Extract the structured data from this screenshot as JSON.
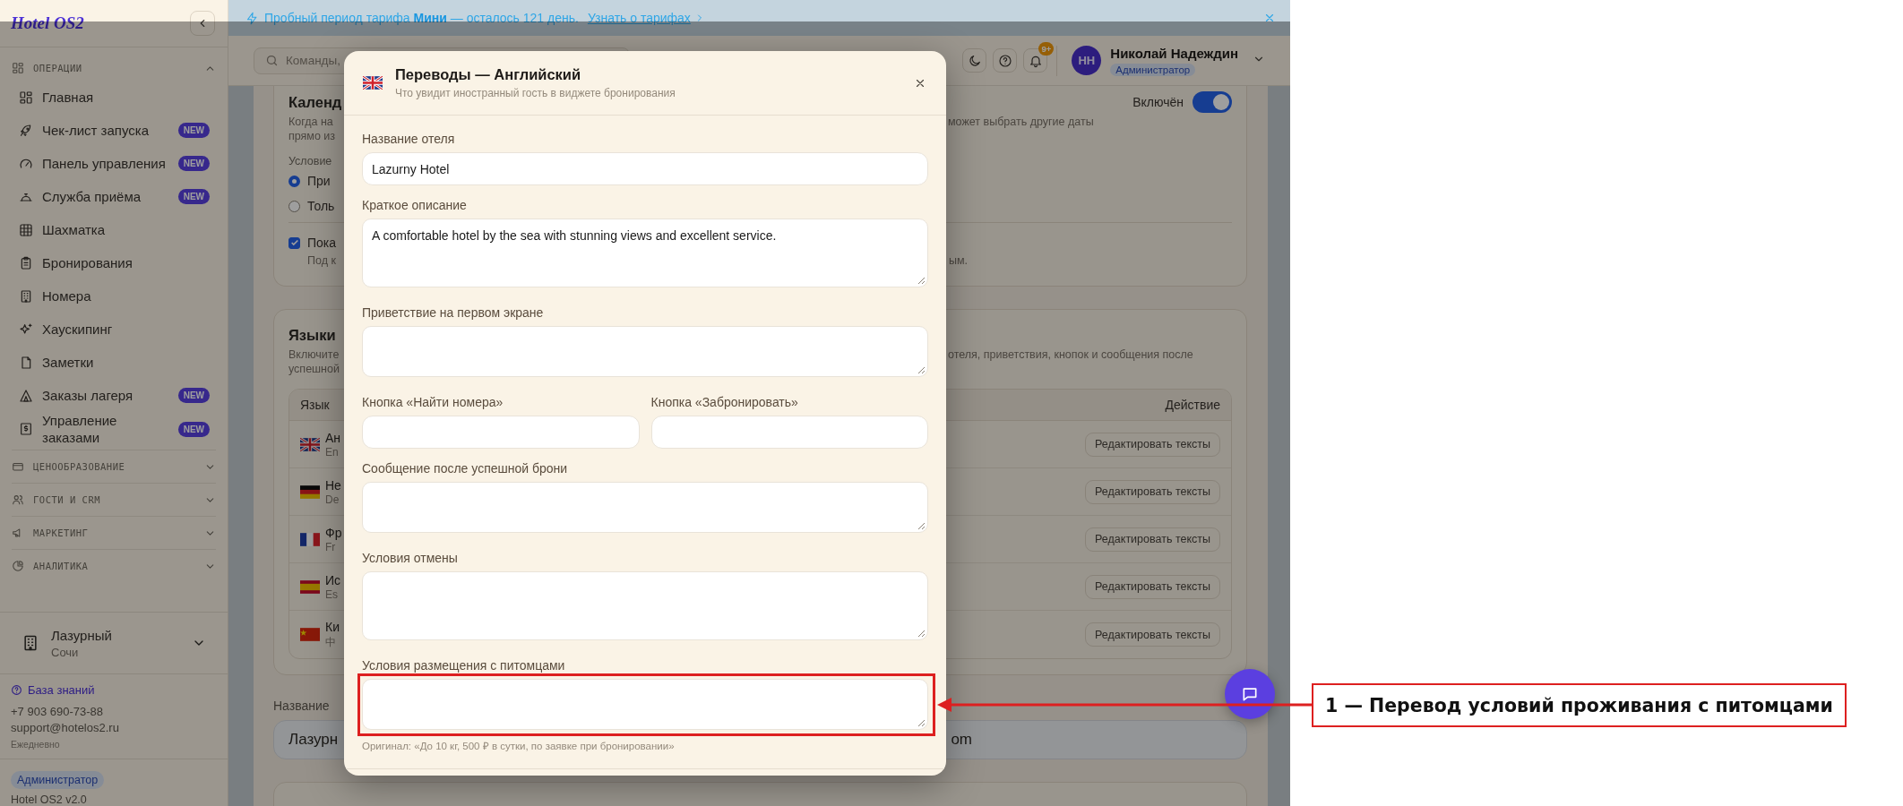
{
  "sidebar": {
    "logo": "Hotel OS2",
    "sections": [
      {
        "title": "ОПЕРАЦИИ",
        "expanded": true,
        "items": [
          {
            "label": "Главная"
          },
          {
            "label": "Чек-лист запуска",
            "badge": "NEW"
          },
          {
            "label": "Панель управления",
            "badge": "NEW"
          },
          {
            "label": "Служба приёма",
            "badge": "NEW"
          },
          {
            "label": "Шахматка"
          },
          {
            "label": "Бронирования"
          },
          {
            "label": "Номера"
          },
          {
            "label": "Хаускипинг"
          },
          {
            "label": "Заметки"
          },
          {
            "label": "Заказы лагеря",
            "badge": "NEW"
          },
          {
            "label": "Управление заказами",
            "badge": "NEW"
          }
        ]
      },
      {
        "title": "ЦЕНООБРАЗОВАНИЕ",
        "expanded": false
      },
      {
        "title": "ГОСТИ И CRM",
        "expanded": false
      },
      {
        "title": "МАРКЕТИНГ",
        "expanded": false
      },
      {
        "title": "АНАЛИТИКА",
        "expanded": false
      }
    ],
    "hotel": {
      "name": "Лазурный",
      "city": "Сочи"
    },
    "support": {
      "link": "База знаний",
      "phone": "+7 903 690-73-88",
      "email": "support@hotelos2.ru",
      "hours": "Ежедневно"
    },
    "role": "Администратор",
    "version": "Hotel OS2 v2.0"
  },
  "banner": {
    "text": "Пробный период тарифа **Мини** — осталось 121 день.",
    "link": "Узнать о тарифах"
  },
  "header": {
    "search": {
      "placeholder": "Команды,"
    },
    "notifications": "9+",
    "user": {
      "initials": "НН",
      "name": "Николай Надеждин",
      "role": "Администратор"
    }
  },
  "calendar_card": {
    "title": "Календ",
    "toggle": {
      "label": "Включён",
      "on": true
    },
    "description": [
      {
        "left": "Когда на",
        "right": "может выбрать другие даты"
      },
      {
        "left": "прямо из"
      }
    ],
    "condition_label": "Условие",
    "options": [
      {
        "label": "При",
        "selected": true
      },
      {
        "label": "Толь",
        "selected": false
      }
    ],
    "checkbox": {
      "label": "Пока",
      "checked": true,
      "hint": "Под к",
      "hint_right": "ым."
    }
  },
  "languages_card": {
    "title": "Языки",
    "description": [
      {
        "left": "Включите",
        "right": "отеля, приветствия, кнопок и сообщения после"
      },
      {
        "left": "успешной"
      }
    ],
    "columns": [
      "Язык",
      "Действие"
    ],
    "rows": [
      {
        "name": "Ан",
        "native": "En",
        "action": "Редактировать тексты"
      },
      {
        "name": "Не",
        "native": "De",
        "action": "Редактировать тексты"
      },
      {
        "name": "Фр",
        "native": "Fr",
        "action": "Редактировать тексты"
      },
      {
        "name": "Ис",
        "native": "Es",
        "action": "Редактировать тексты"
      },
      {
        "name": "Ки",
        "native": "中",
        "action": "Редактировать тексты"
      }
    ]
  },
  "hotel_name_field": {
    "label": "Название",
    "value_left": "Лазурн",
    "value_right": "om"
  },
  "modal": {
    "title": "Переводы — Английский",
    "subtitle": "Что увидит иностранный гость в виджете бронирования",
    "fields": [
      {
        "label": "Название отеля",
        "kind": "input",
        "value": "Lazurny Hotel"
      },
      {
        "label": "Краткое описание",
        "kind": "textarea-tall",
        "value": "A comfortable hotel by the sea with stunning views and excellent service."
      },
      {
        "label": "Приветствие на первом экране",
        "kind": "textarea"
      },
      {
        "label": "Кнопка «Найти номера»",
        "kind": "half-input"
      },
      {
        "label": "Кнопка «Забронировать»",
        "kind": "half-input"
      },
      {
        "label": "Сообщение после успешной брони",
        "kind": "textarea"
      },
      {
        "label": "Условия отмены",
        "kind": "textarea-tall"
      },
      {
        "label": "Условия размещения с питомцами",
        "kind": "textarea",
        "annotated": true,
        "hint": "Оригинал: «До 10 кг, 500 ₽ в сутки, по заявке при бронировании»"
      }
    ]
  },
  "annotation": {
    "label": "1 — Перевод условий проживания с питомцами"
  }
}
